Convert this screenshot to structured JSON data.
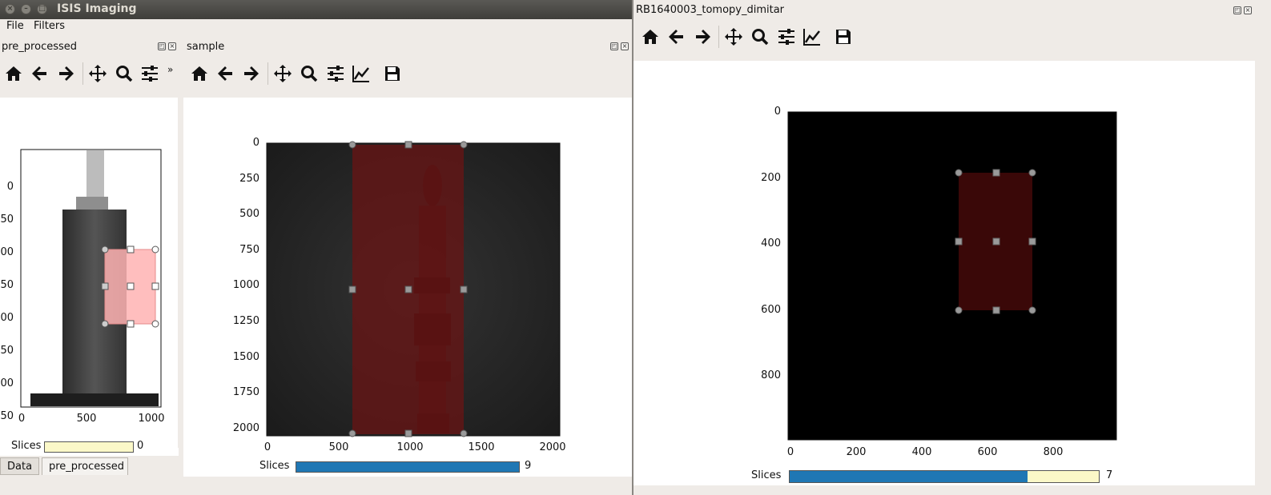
{
  "app": {
    "title": "ISIS Imaging"
  },
  "menu": {
    "file": "File",
    "filters": "Filters"
  },
  "docks": {
    "pre_processed": {
      "title": "pre_processed"
    },
    "sample": {
      "title": "sample"
    }
  },
  "left_plot": {
    "y_ticks": [
      "0",
      "50",
      "00",
      "50",
      "00",
      "50",
      "00",
      "50"
    ],
    "x_ticks": [
      "0",
      "500",
      "1000"
    ],
    "slices_label": "Slices",
    "slices_value": "0",
    "slices_fraction": 0.0
  },
  "mid_plot": {
    "y_ticks": [
      "0",
      "250",
      "500",
      "750",
      "1000",
      "1250",
      "1500",
      "1750",
      "2000"
    ],
    "x_ticks": [
      "0",
      "500",
      "1000",
      "1500",
      "2000"
    ],
    "slices_label": "Slices",
    "slices_value": "9",
    "slices_fraction": 1.0
  },
  "right_window": {
    "title": "RB1640003_tomopy_dimitar",
    "y_ticks": [
      "0",
      "200",
      "400",
      "600",
      "800"
    ],
    "x_ticks": [
      "0",
      "200",
      "400",
      "600",
      "800"
    ],
    "slices_label": "Slices",
    "slices_value": "7",
    "slices_fraction": 0.77
  },
  "tabs": {
    "data": "Data",
    "pre_processed": "pre_processed"
  },
  "colors": {
    "slider_fill": "#1f77b4",
    "slider_track": "#fbf8c8",
    "roi_red": "#ffb3b3",
    "roi_dark": "#5a0f0f"
  },
  "icons": [
    "home-icon",
    "back-arrow-icon",
    "forward-arrow-icon",
    "pan-icon",
    "zoom-icon",
    "configure-subplots-icon",
    "edit-axis-icon",
    "save-icon"
  ]
}
